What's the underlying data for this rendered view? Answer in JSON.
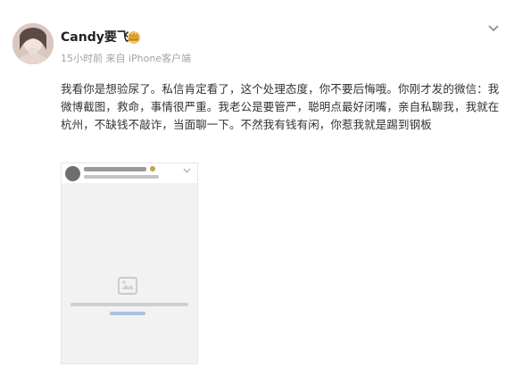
{
  "post": {
    "username": "Candy要飞",
    "meta": "15小时前  来自 iPhone客户端",
    "body": "我看你是想验尿了。私信肯定看了，这个处理态度，你不要后悔哦。你刚才发的微信：我微博截图，救命，事情很严重。我老公是要管严，聪明点最好闭嘴，亲自私聊我，我就在杭州，不缺钱不敲诈，当面聊一下。不然我有钱有闲，你惹我就是踢到钢板"
  },
  "icons": {
    "avatar": "avatar",
    "crown": "crown-badge-icon",
    "menu": "chevron-down-icon",
    "image_placeholder": "image-placeholder-icon"
  },
  "colors": {
    "text": "#333333",
    "meta": "#a3a3a3",
    "crown": "#e0a53a"
  }
}
